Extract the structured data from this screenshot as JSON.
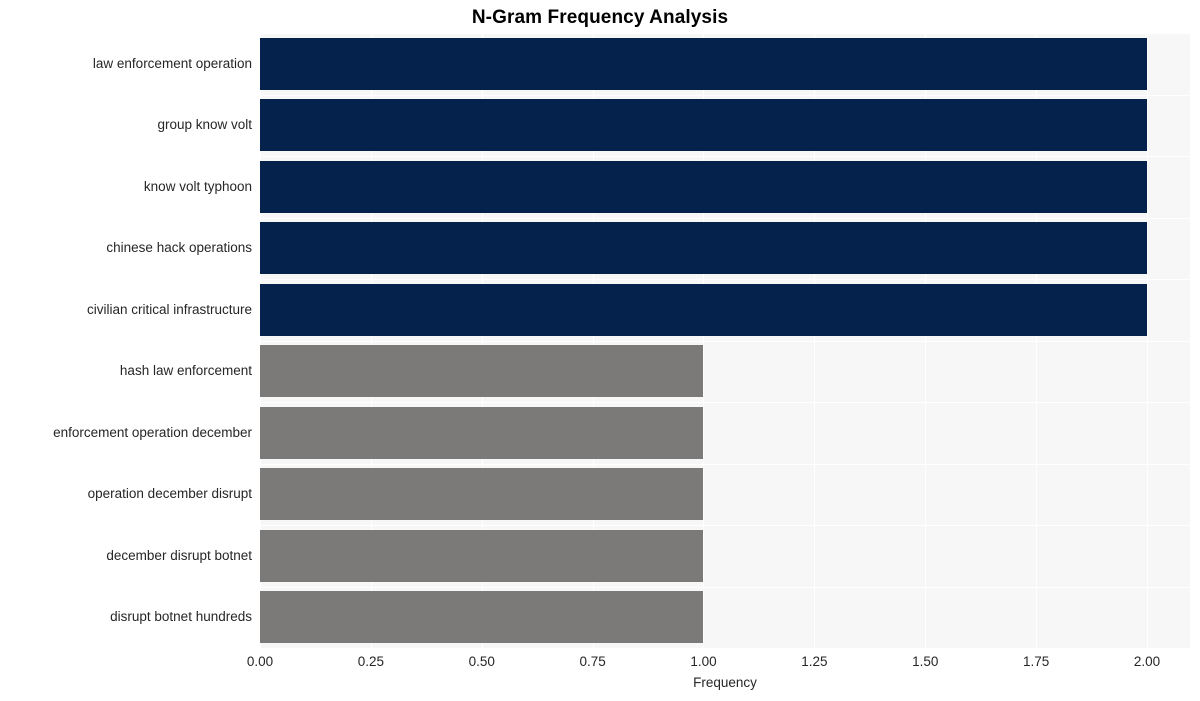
{
  "chart_data": {
    "type": "bar",
    "orientation": "horizontal",
    "title": "N-Gram Frequency Analysis",
    "xlabel": "Frequency",
    "ylabel": "",
    "categories": [
      "law enforcement operation",
      "group know volt",
      "know volt typhoon",
      "chinese hack operations",
      "civilian critical infrastructure",
      "hash law enforcement",
      "enforcement operation december",
      "operation december disrupt",
      "december disrupt botnet",
      "disrupt botnet hundreds"
    ],
    "values": [
      2,
      2,
      2,
      2,
      2,
      1,
      1,
      1,
      1,
      1
    ],
    "bar_colors": [
      "#04224c",
      "#04224c",
      "#04224c",
      "#04224c",
      "#04224c",
      "#7b7a79",
      "#7b7a79",
      "#7b7a79",
      "#7b7a79",
      "#7b7a79"
    ],
    "xlim": [
      0.0,
      2.097
    ],
    "xticks": [
      0.0,
      0.25,
      0.5,
      0.75,
      1.0,
      1.25,
      1.5,
      1.75,
      2.0
    ],
    "xtick_labels": [
      "0.00",
      "0.25",
      "0.50",
      "0.75",
      "1.00",
      "1.25",
      "1.50",
      "1.75",
      "2.00"
    ],
    "grid": true,
    "grid_color": "#ffffff",
    "legend": null,
    "plot_background": "#f7f7f7",
    "figure_background": "#ffffff",
    "text_color": "#262626"
  }
}
